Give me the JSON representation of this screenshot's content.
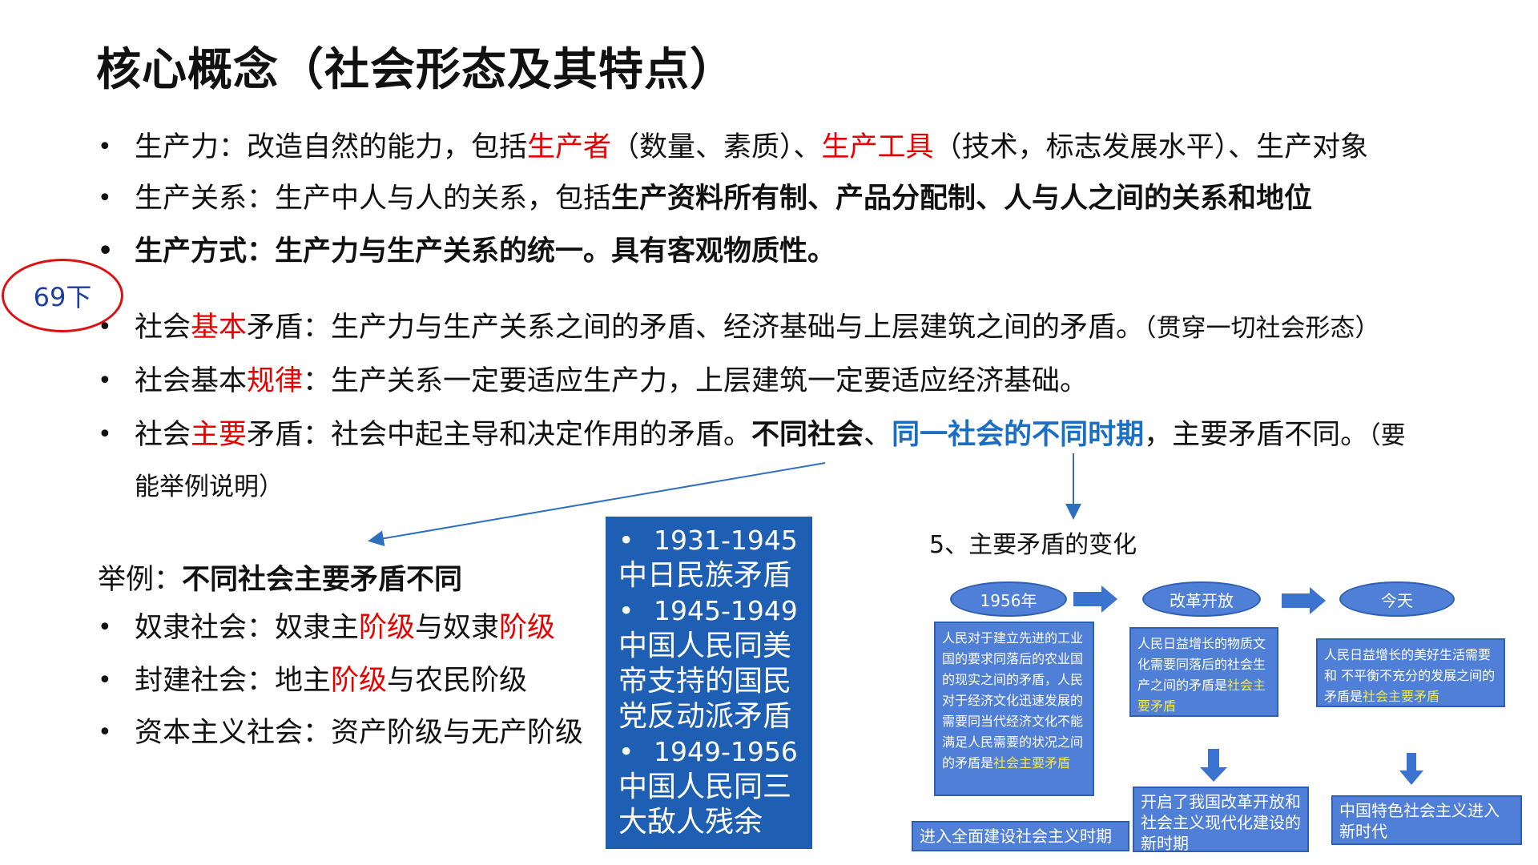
{
  "title": "核心概念（社会形态及其特点）",
  "stamp": "69下",
  "bullets": {
    "b1": {
      "a": "生产力：改造自然的能力，包括",
      "b": "生产者",
      "c": "（数量、素质）、",
      "d": "生产工具",
      "e": "（技术，标志发展水平）、生产对象"
    },
    "b2": {
      "a": "生产关系：生产中人与人的关系，包括",
      "b": "生产资料所有制、产品分配制、人与人之间的关系和地位"
    },
    "b3": {
      "a": "生产方式：生产力与生产关系的统一。具有客观物质性。"
    },
    "b4": {
      "a": "社会",
      "b": "基本",
      "c": "矛盾：生产力与生产关系之间的矛盾、经济基础与上层建筑之间的矛盾。",
      "d": "（贯穿一切社会形态）"
    },
    "b5": {
      "a": "社会基本",
      "b": "规律",
      "c": "：生产关系一定要适应生产力，上层建筑一定要适应经济基础。"
    },
    "b6": {
      "a": "社会",
      "b": "主要",
      "c": "矛盾：社会中起主导和决定作用的矛盾。",
      "d": "不同社会",
      "e": "、",
      "f": "同一社会的不同时期",
      "g": "，主要矛盾不同。",
      "h": "（要"
    },
    "b6_cont": "能举例说明）"
  },
  "examples": {
    "head_a": "举例：",
    "head_b": "不同社会主要矛盾不同",
    "e1": {
      "a": "奴隶社会：奴隶主",
      "b": "阶级",
      "c": "与奴隶",
      "d": "阶级"
    },
    "e2": {
      "a": "封建社会：地主",
      "b": "阶级",
      "c": "与农民阶级"
    },
    "e3": {
      "a": "资本主义社会：资产阶级与无产阶级"
    }
  },
  "timeline": {
    "y1": "1931-1945",
    "t1": "中日民族矛盾",
    "y2": "1945-1949",
    "t2": "中国人民同美帝支持的国民党反动派矛盾",
    "y3": "1949-1956",
    "t3": "中国人民同三大敌人残余"
  },
  "flow": {
    "title": "5、主要矛盾的变化",
    "o1": "1956年",
    "o2": "改革开放",
    "o3": "今天",
    "box1": "人民对于建立先进的工业国的要求同落后的农业国的现实之间的矛盾，人民对于经济文化迅速发展的需要同当代经济文化不能满足人民需要的状况之间的矛盾是",
    "box1_hl": "社会主要矛盾",
    "box2": "人民日益增长的物质文化需要同落后的社会生产之间的矛盾是",
    "box2_hl": "社会主要矛盾",
    "box3": "人民日益增长的美好生活需要 和 不平衡不充分的发展之间的矛盾是",
    "box3_hl": "社会主要矛盾",
    "r1": "进入全面建设社会主义时期",
    "r2": "开启了我国改革开放和社会主义现代化建设的新时期",
    "r3": "中国特色社会主义进入新时代"
  },
  "colors": {
    "red": "#e60000",
    "blue": "#1a6fc4",
    "panel": "#1f5fb3",
    "flow_box": "#4f7fd6",
    "highlight": "#f6e84a"
  }
}
